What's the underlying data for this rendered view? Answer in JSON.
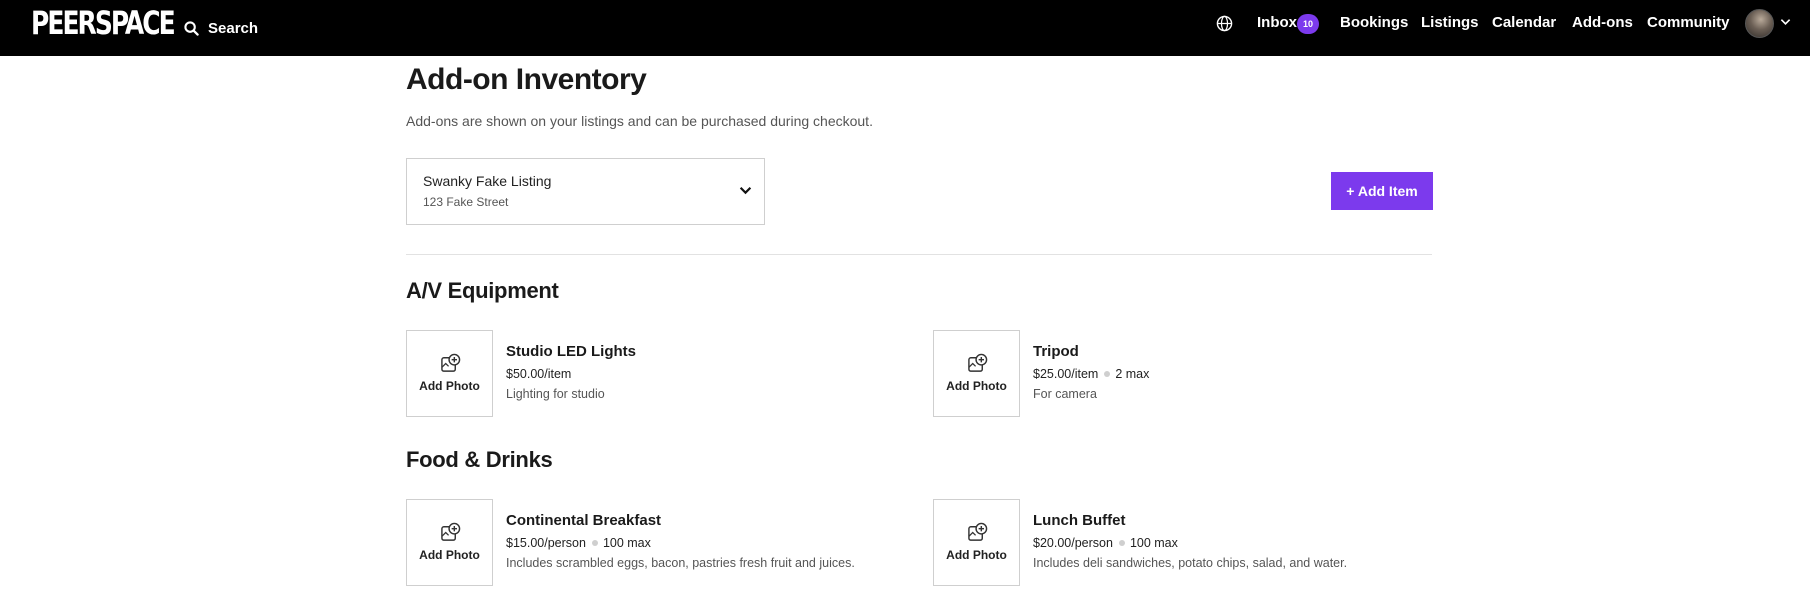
{
  "nav": {
    "logo": "PEERSPACE",
    "search_label": "Search",
    "inbox_label": "Inbox",
    "inbox_count": "10",
    "bookings_label": "Bookings",
    "listings_label": "Listings",
    "calendar_label": "Calendar",
    "addons_label": "Add-ons",
    "community_label": "Community"
  },
  "page": {
    "title": "Add-on Inventory",
    "subtitle": "Add-ons are shown on your listings and can be purchased during checkout."
  },
  "listing": {
    "name": "Swanky Fake Listing",
    "address": "123 Fake Street"
  },
  "add_item_label": "+ Add Item",
  "add_photo_label": "Add Photo",
  "sections": [
    {
      "title": "A/V Equipment",
      "items": [
        {
          "name": "Studio LED Lights",
          "price": "$50.00/item",
          "max": "",
          "description": "Lighting for studio"
        },
        {
          "name": "Tripod",
          "price": "$25.00/item",
          "max": "2 max",
          "description": "For camera"
        }
      ]
    },
    {
      "title": "Food & Drinks",
      "items": [
        {
          "name": "Continental Breakfast",
          "price": "$15.00/person",
          "max": "100 max",
          "description": "Includes scrambled eggs, bacon, pastries fresh fruit and juices."
        },
        {
          "name": "Lunch Buffet",
          "price": "$20.00/person",
          "max": "100 max",
          "description": "Includes deli sandwiches, potato chips, salad, and water."
        }
      ]
    }
  ],
  "colors": {
    "accent": "#7c3aed",
    "navbar": "#000000"
  }
}
